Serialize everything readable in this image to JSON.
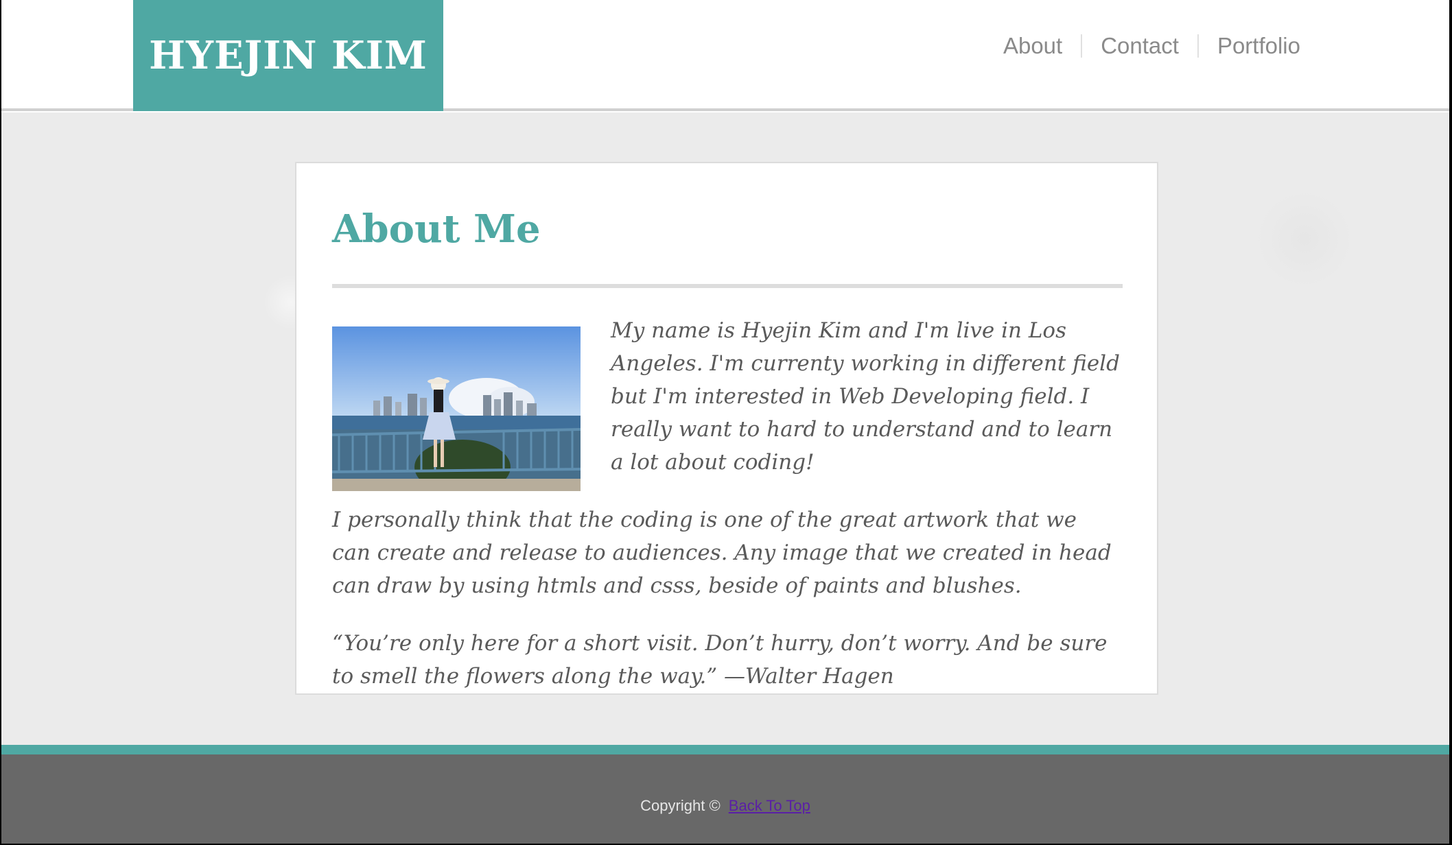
{
  "site": {
    "logo_text": "HYEJIN KIM"
  },
  "nav": {
    "items": [
      {
        "label": "About"
      },
      {
        "label": "Contact"
      },
      {
        "label": "Portfolio"
      }
    ]
  },
  "main": {
    "heading": "About Me",
    "paragraphs": [
      "My name is Hyejin Kim and I'm live in Los Angeles. I'm currenty working in different field but I'm interested in Web Developing field. I really want to hard to understand and to learn a lot about coding!",
      "I personally think that the coding is one of the great artwork that we can create and release to audiences. Any image that we created in head can draw by using htmls and csss, beside of paints and blushes.",
      "“You’re only here for a short visit. Don’t hurry, don’t worry. And be sure to smell the flowers along the way.” —Walter Hagen"
    ]
  },
  "footer": {
    "copyright": "Copyright ©",
    "back_to_top": "Back To Top"
  },
  "colors": {
    "accent": "#4fa8a3",
    "footer_bg": "#686868",
    "nav_text": "#8a8a8a",
    "body_text": "#5a5a5a"
  }
}
